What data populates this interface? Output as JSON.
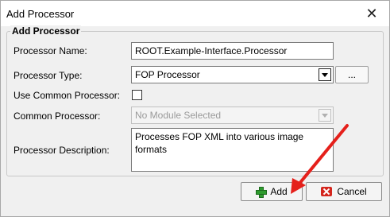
{
  "window": {
    "title": "Add Processor",
    "close_symbol": "✕"
  },
  "group": {
    "title": "Add Processor"
  },
  "fields": {
    "name_label": "Processor Name:",
    "name_value": "ROOT.Example-Interface.Processor",
    "type_label": "Processor Type:",
    "type_value": "FOP Processor",
    "browse_label": "...",
    "use_common_label": "Use Common Processor:",
    "use_common_checked": false,
    "common_label": "Common Processor:",
    "common_value": "No Module Selected",
    "description_label": "Processor Description:",
    "description_value": "Processes FOP XML into various image formats"
  },
  "buttons": {
    "add_label": "Add",
    "cancel_label": "Cancel"
  },
  "icons": {
    "add": "plus-icon",
    "cancel": "cancel-x-icon",
    "close": "close-icon",
    "dropdown": "chevron-down-icon"
  },
  "colors": {
    "annotation_arrow": "#e5201b",
    "add_icon": "#2e9b2e",
    "cancel_icon": "#d4261d"
  }
}
